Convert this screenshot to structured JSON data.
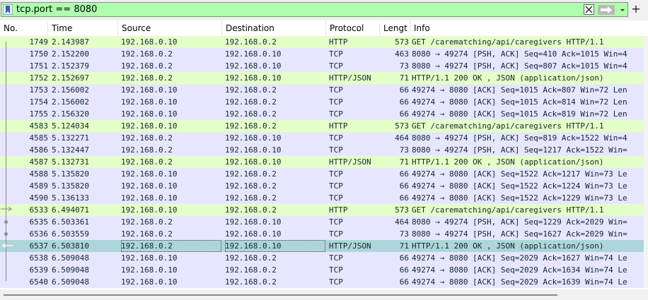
{
  "filter": {
    "value": "tcp.port == 8080",
    "add_label": "+",
    "color": "#afffaf"
  },
  "columns": [
    {
      "key": "no",
      "label": "No."
    },
    {
      "key": "time",
      "label": "Time"
    },
    {
      "key": "source",
      "label": "Source"
    },
    {
      "key": "destination",
      "label": "Destination"
    },
    {
      "key": "protocol",
      "label": "Protocol"
    },
    {
      "key": "length",
      "label": "Lengt"
    },
    {
      "key": "info",
      "label": "Info"
    }
  ],
  "colors": {
    "http_row": "#e4ffc7",
    "tcp_row": "#e7e6ff",
    "selected_row": "#aed6da"
  },
  "rows": [
    {
      "no": "1749",
      "time": "2.143987",
      "source": "192.168.0.10",
      "destination": "192.168.0.2",
      "protocol": "HTTP",
      "length": "573",
      "info": "GET /carematching/api/caregivers HTTP/1.1",
      "kind": "http"
    },
    {
      "no": "1750",
      "time": "2.152200",
      "source": "192.168.0.2",
      "destination": "192.168.0.10",
      "protocol": "TCP",
      "length": "463",
      "info": "8080 → 49274 [PSH, ACK] Seq=410 Ack=1015 Win=4",
      "kind": "tcp"
    },
    {
      "no": "1751",
      "time": "2.152379",
      "source": "192.168.0.2",
      "destination": "192.168.0.10",
      "protocol": "TCP",
      "length": "73",
      "info": "8080 → 49274 [PSH, ACK] Seq=807 Ack=1015 Win=4",
      "kind": "tcp"
    },
    {
      "no": "1752",
      "time": "2.152697",
      "source": "192.168.0.2",
      "destination": "192.168.0.10",
      "protocol": "HTTP/JSON",
      "length": "71",
      "info": "HTTP/1.1 200 OK , JSON (application/json)",
      "kind": "http"
    },
    {
      "no": "1753",
      "time": "2.156002",
      "source": "192.168.0.10",
      "destination": "192.168.0.2",
      "protocol": "TCP",
      "length": "66",
      "info": "49274 → 8080 [ACK] Seq=1015 Ack=807 Win=72 Len",
      "kind": "tcp"
    },
    {
      "no": "1754",
      "time": "2.156002",
      "source": "192.168.0.10",
      "destination": "192.168.0.2",
      "protocol": "TCP",
      "length": "66",
      "info": "49274 → 8080 [ACK] Seq=1015 Ack=814 Win=72 Len",
      "kind": "tcp"
    },
    {
      "no": "1755",
      "time": "2.156320",
      "source": "192.168.0.10",
      "destination": "192.168.0.2",
      "protocol": "TCP",
      "length": "66",
      "info": "49274 → 8080 [ACK] Seq=1015 Ack=819 Win=72 Len",
      "kind": "tcp"
    },
    {
      "no": "4583",
      "time": "5.124034",
      "source": "192.168.0.10",
      "destination": "192.168.0.2",
      "protocol": "HTTP",
      "length": "573",
      "info": "GET /carematching/api/caregivers HTTP/1.1",
      "kind": "http"
    },
    {
      "no": "4585",
      "time": "5.132271",
      "source": "192.168.0.2",
      "destination": "192.168.0.10",
      "protocol": "TCP",
      "length": "464",
      "info": "8080 → 49274 [PSH, ACK] Seq=819 Ack=1522 Win=4",
      "kind": "tcp"
    },
    {
      "no": "4586",
      "time": "5.132447",
      "source": "192.168.0.2",
      "destination": "192.168.0.10",
      "protocol": "TCP",
      "length": "73",
      "info": "8080 → 49274 [PSH, ACK] Seq=1217 Ack=1522 Win=",
      "kind": "tcp"
    },
    {
      "no": "4587",
      "time": "5.132731",
      "source": "192.168.0.2",
      "destination": "192.168.0.10",
      "protocol": "HTTP/JSON",
      "length": "71",
      "info": "HTTP/1.1 200 OK , JSON (application/json)",
      "kind": "http"
    },
    {
      "no": "4588",
      "time": "5.135820",
      "source": "192.168.0.10",
      "destination": "192.168.0.2",
      "protocol": "TCP",
      "length": "66",
      "info": "49274 → 8080 [ACK] Seq=1522 Ack=1217 Win=73 Le",
      "kind": "tcp"
    },
    {
      "no": "4589",
      "time": "5.135820",
      "source": "192.168.0.10",
      "destination": "192.168.0.2",
      "protocol": "TCP",
      "length": "66",
      "info": "49274 → 8080 [ACK] Seq=1522 Ack=1224 Win=73 Le",
      "kind": "tcp"
    },
    {
      "no": "4590",
      "time": "5.136133",
      "source": "192.168.0.10",
      "destination": "192.168.0.2",
      "protocol": "TCP",
      "length": "66",
      "info": "49274 → 8080 [ACK] Seq=1522 Ack=1229 Win=73 Le",
      "kind": "tcp"
    },
    {
      "no": "6533",
      "time": "6.494071",
      "source": "192.168.0.10",
      "destination": "192.168.0.2",
      "protocol": "HTTP",
      "length": "573",
      "info": "GET /carematching/api/caregivers HTTP/1.1",
      "kind": "http"
    },
    {
      "no": "6535",
      "time": "6.503361",
      "source": "192.168.0.2",
      "destination": "192.168.0.10",
      "protocol": "TCP",
      "length": "464",
      "info": "8080 → 49274 [PSH, ACK] Seq=1229 Ack=2029 Win=",
      "kind": "tcp"
    },
    {
      "no": "6536",
      "time": "6.503559",
      "source": "192.168.0.2",
      "destination": "192.168.0.10",
      "protocol": "TCP",
      "length": "73",
      "info": "8080 → 49274 [PSH, ACK] Seq=1627 Ack=2029 Win=",
      "kind": "tcp"
    },
    {
      "no": "6537",
      "time": "6.503810",
      "source": "192.168.0.2",
      "destination": "192.168.0.10",
      "protocol": "HTTP/JSON",
      "length": "71",
      "info": "HTTP/1.1 200 OK , JSON (application/json)",
      "kind": "selected"
    },
    {
      "no": "6538",
      "time": "6.509048",
      "source": "192.168.0.10",
      "destination": "192.168.0.2",
      "protocol": "TCP",
      "length": "66",
      "info": "49274 → 8080 [ACK] Seq=2029 Ack=1627 Win=74 Le",
      "kind": "tcp"
    },
    {
      "no": "6539",
      "time": "6.509048",
      "source": "192.168.0.10",
      "destination": "192.168.0.2",
      "protocol": "TCP",
      "length": "66",
      "info": "49274 → 8080 [ACK] Seq=2029 Ack=1634 Win=74 Le",
      "kind": "tcp"
    },
    {
      "no": "6540",
      "time": "6.509048",
      "source": "192.168.0.10",
      "destination": "192.168.0.2",
      "protocol": "TCP",
      "length": "66",
      "info": "49274 → 8080 [ACK] Seq=2029 Ack=1639 Win=74 Le",
      "kind": "tcp"
    }
  ]
}
